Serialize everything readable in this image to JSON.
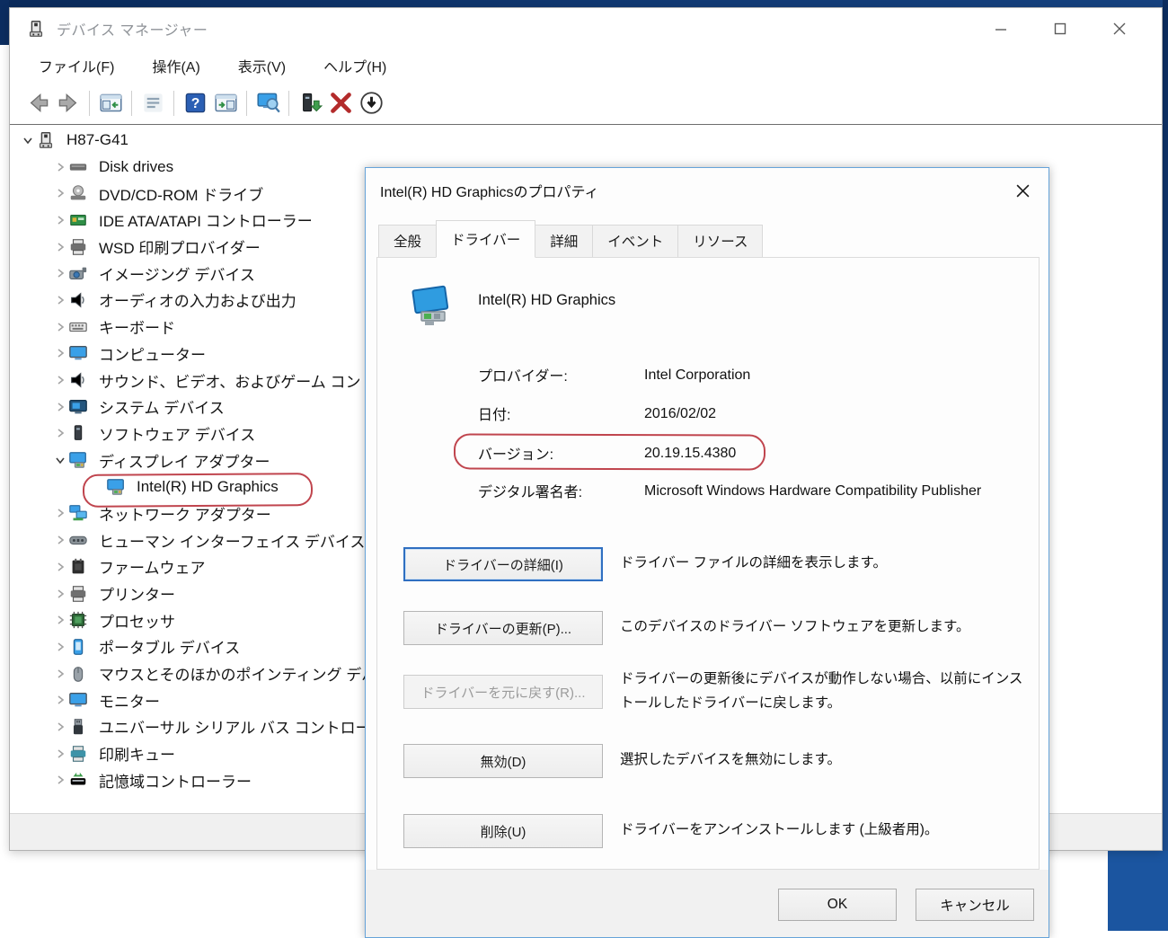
{
  "desktop": {
    "navy": "#0c2d60",
    "blue_block": "#1b55a0"
  },
  "annotation_color": "#c0454e",
  "window": {
    "title": "デバイス マネージャー",
    "menu": [
      "ファイル(F)",
      "操作(A)",
      "表示(V)",
      "ヘルプ(H)"
    ],
    "toolbar_icons": [
      "back-arrow-icon",
      "forward-arrow-icon",
      "sep",
      "show-tree-panel-icon",
      "sep",
      "properties-list-icon",
      "sep",
      "help-icon",
      "show-action-panel-icon",
      "sep",
      "scan-hardware-changes-icon",
      "sep",
      "update-driver-icon",
      "uninstall-red-x-icon",
      "disable-down-arrow-icon"
    ],
    "tree": [
      {
        "label": "H87-G41",
        "level": 0,
        "icon": "pc-icon",
        "chevron": "expanded",
        "annotated": false
      },
      {
        "label": "Disk drives",
        "level": 1,
        "icon": "disk-drive-icon",
        "chevron": "collapsed",
        "annotated": false
      },
      {
        "label": "DVD/CD-ROM ドライブ",
        "level": 1,
        "icon": "dvd-drive-icon",
        "chevron": "collapsed",
        "annotated": false
      },
      {
        "label": "IDE ATA/ATAPI コントローラー",
        "level": 1,
        "icon": "ide-controller-icon",
        "chevron": "collapsed",
        "annotated": false
      },
      {
        "label": "WSD 印刷プロバイダー",
        "level": 1,
        "icon": "printer-icon",
        "chevron": "collapsed",
        "annotated": false
      },
      {
        "label": "イメージング デバイス",
        "level": 1,
        "icon": "imaging-device-icon",
        "chevron": "collapsed",
        "annotated": false
      },
      {
        "label": "オーディオの入力および出力",
        "level": 1,
        "icon": "audio-icon",
        "chevron": "collapsed",
        "annotated": false
      },
      {
        "label": "キーボード",
        "level": 1,
        "icon": "keyboard-icon",
        "chevron": "collapsed",
        "annotated": false
      },
      {
        "label": "コンピューター",
        "level": 1,
        "icon": "monitor-icon",
        "chevron": "collapsed",
        "annotated": false
      },
      {
        "label": "サウンド、ビデオ、およびゲーム コントローラー",
        "level": 1,
        "icon": "audio-icon",
        "chevron": "collapsed",
        "annotated": false
      },
      {
        "label": "システム デバイス",
        "level": 1,
        "icon": "system-device-icon",
        "chevron": "collapsed",
        "annotated": false
      },
      {
        "label": "ソフトウェア デバイス",
        "level": 1,
        "icon": "software-device-icon",
        "chevron": "collapsed",
        "annotated": false
      },
      {
        "label": "ディスプレイ アダプター",
        "level": 1,
        "icon": "display-adapter-icon",
        "chevron": "expanded",
        "annotated": false
      },
      {
        "label": "Intel(R) HD Graphics",
        "level": 2,
        "icon": "display-adapter-icon",
        "chevron": "none",
        "annotated": true
      },
      {
        "label": "ネットワーク アダプター",
        "level": 1,
        "icon": "network-adapter-icon",
        "chevron": "collapsed",
        "annotated": false
      },
      {
        "label": "ヒューマン インターフェイス デバイス",
        "level": 1,
        "icon": "hid-icon",
        "chevron": "collapsed",
        "annotated": false
      },
      {
        "label": "ファームウェア",
        "level": 1,
        "icon": "firmware-icon",
        "chevron": "collapsed",
        "annotated": false
      },
      {
        "label": "プリンター",
        "level": 1,
        "icon": "printer-icon",
        "chevron": "collapsed",
        "annotated": false
      },
      {
        "label": "プロセッサ",
        "level": 1,
        "icon": "processor-icon",
        "chevron": "collapsed",
        "annotated": false
      },
      {
        "label": "ポータブル デバイス",
        "level": 1,
        "icon": "portable-device-icon",
        "chevron": "collapsed",
        "annotated": false
      },
      {
        "label": "マウスとそのほかのポインティング デバイス",
        "level": 1,
        "icon": "mouse-icon",
        "chevron": "collapsed",
        "annotated": false
      },
      {
        "label": "モニター",
        "level": 1,
        "icon": "monitor-icon",
        "chevron": "collapsed",
        "annotated": false
      },
      {
        "label": "ユニバーサル シリアル バス コントローラー",
        "level": 1,
        "icon": "usb-icon",
        "chevron": "collapsed",
        "annotated": false
      },
      {
        "label": "印刷キュー",
        "level": 1,
        "icon": "print-queue-icon",
        "chevron": "collapsed",
        "annotated": false
      },
      {
        "label": "記憶域コントローラー",
        "level": 1,
        "icon": "storage-controller-icon",
        "chevron": "collapsed",
        "annotated": false
      }
    ]
  },
  "dialog": {
    "title": "Intel(R) HD Graphicsのプロパティ",
    "tabs": [
      {
        "label": "全般",
        "active": false
      },
      {
        "label": "ドライバー",
        "active": true
      },
      {
        "label": "詳細",
        "active": false
      },
      {
        "label": "イベント",
        "active": false
      },
      {
        "label": "リソース",
        "active": false
      }
    ],
    "device_name": "Intel(R) HD Graphics",
    "fields": [
      {
        "label": "プロバイダー:",
        "value": "Intel Corporation",
        "annotated": false
      },
      {
        "label": "日付:",
        "value": "2016/02/02",
        "annotated": false
      },
      {
        "label": "バージョン:",
        "value": "20.19.15.4380",
        "annotated": true
      },
      {
        "label": "デジタル署名者:",
        "value": "Microsoft Windows Hardware Compatibility Publisher",
        "annotated": false
      }
    ],
    "actions": [
      {
        "button": "ドライバーの詳細(I)",
        "desc": "ドライバー ファイルの詳細を表示します。",
        "state": "focused"
      },
      {
        "button": "ドライバーの更新(P)...",
        "desc": "このデバイスのドライバー ソフトウェアを更新します。",
        "state": "normal"
      },
      {
        "button": "ドライバーを元に戻す(R)...",
        "desc": "ドライバーの更新後にデバイスが動作しない場合、以前にインストールしたドライバーに戻します。",
        "state": "disabled"
      },
      {
        "button": "無効(D)",
        "desc": "選択したデバイスを無効にします。",
        "state": "normal"
      },
      {
        "button": "削除(U)",
        "desc": "ドライバーをアンインストールします (上級者用)。",
        "state": "normal"
      }
    ],
    "footer": {
      "ok": "OK",
      "cancel": "キャンセル"
    }
  }
}
